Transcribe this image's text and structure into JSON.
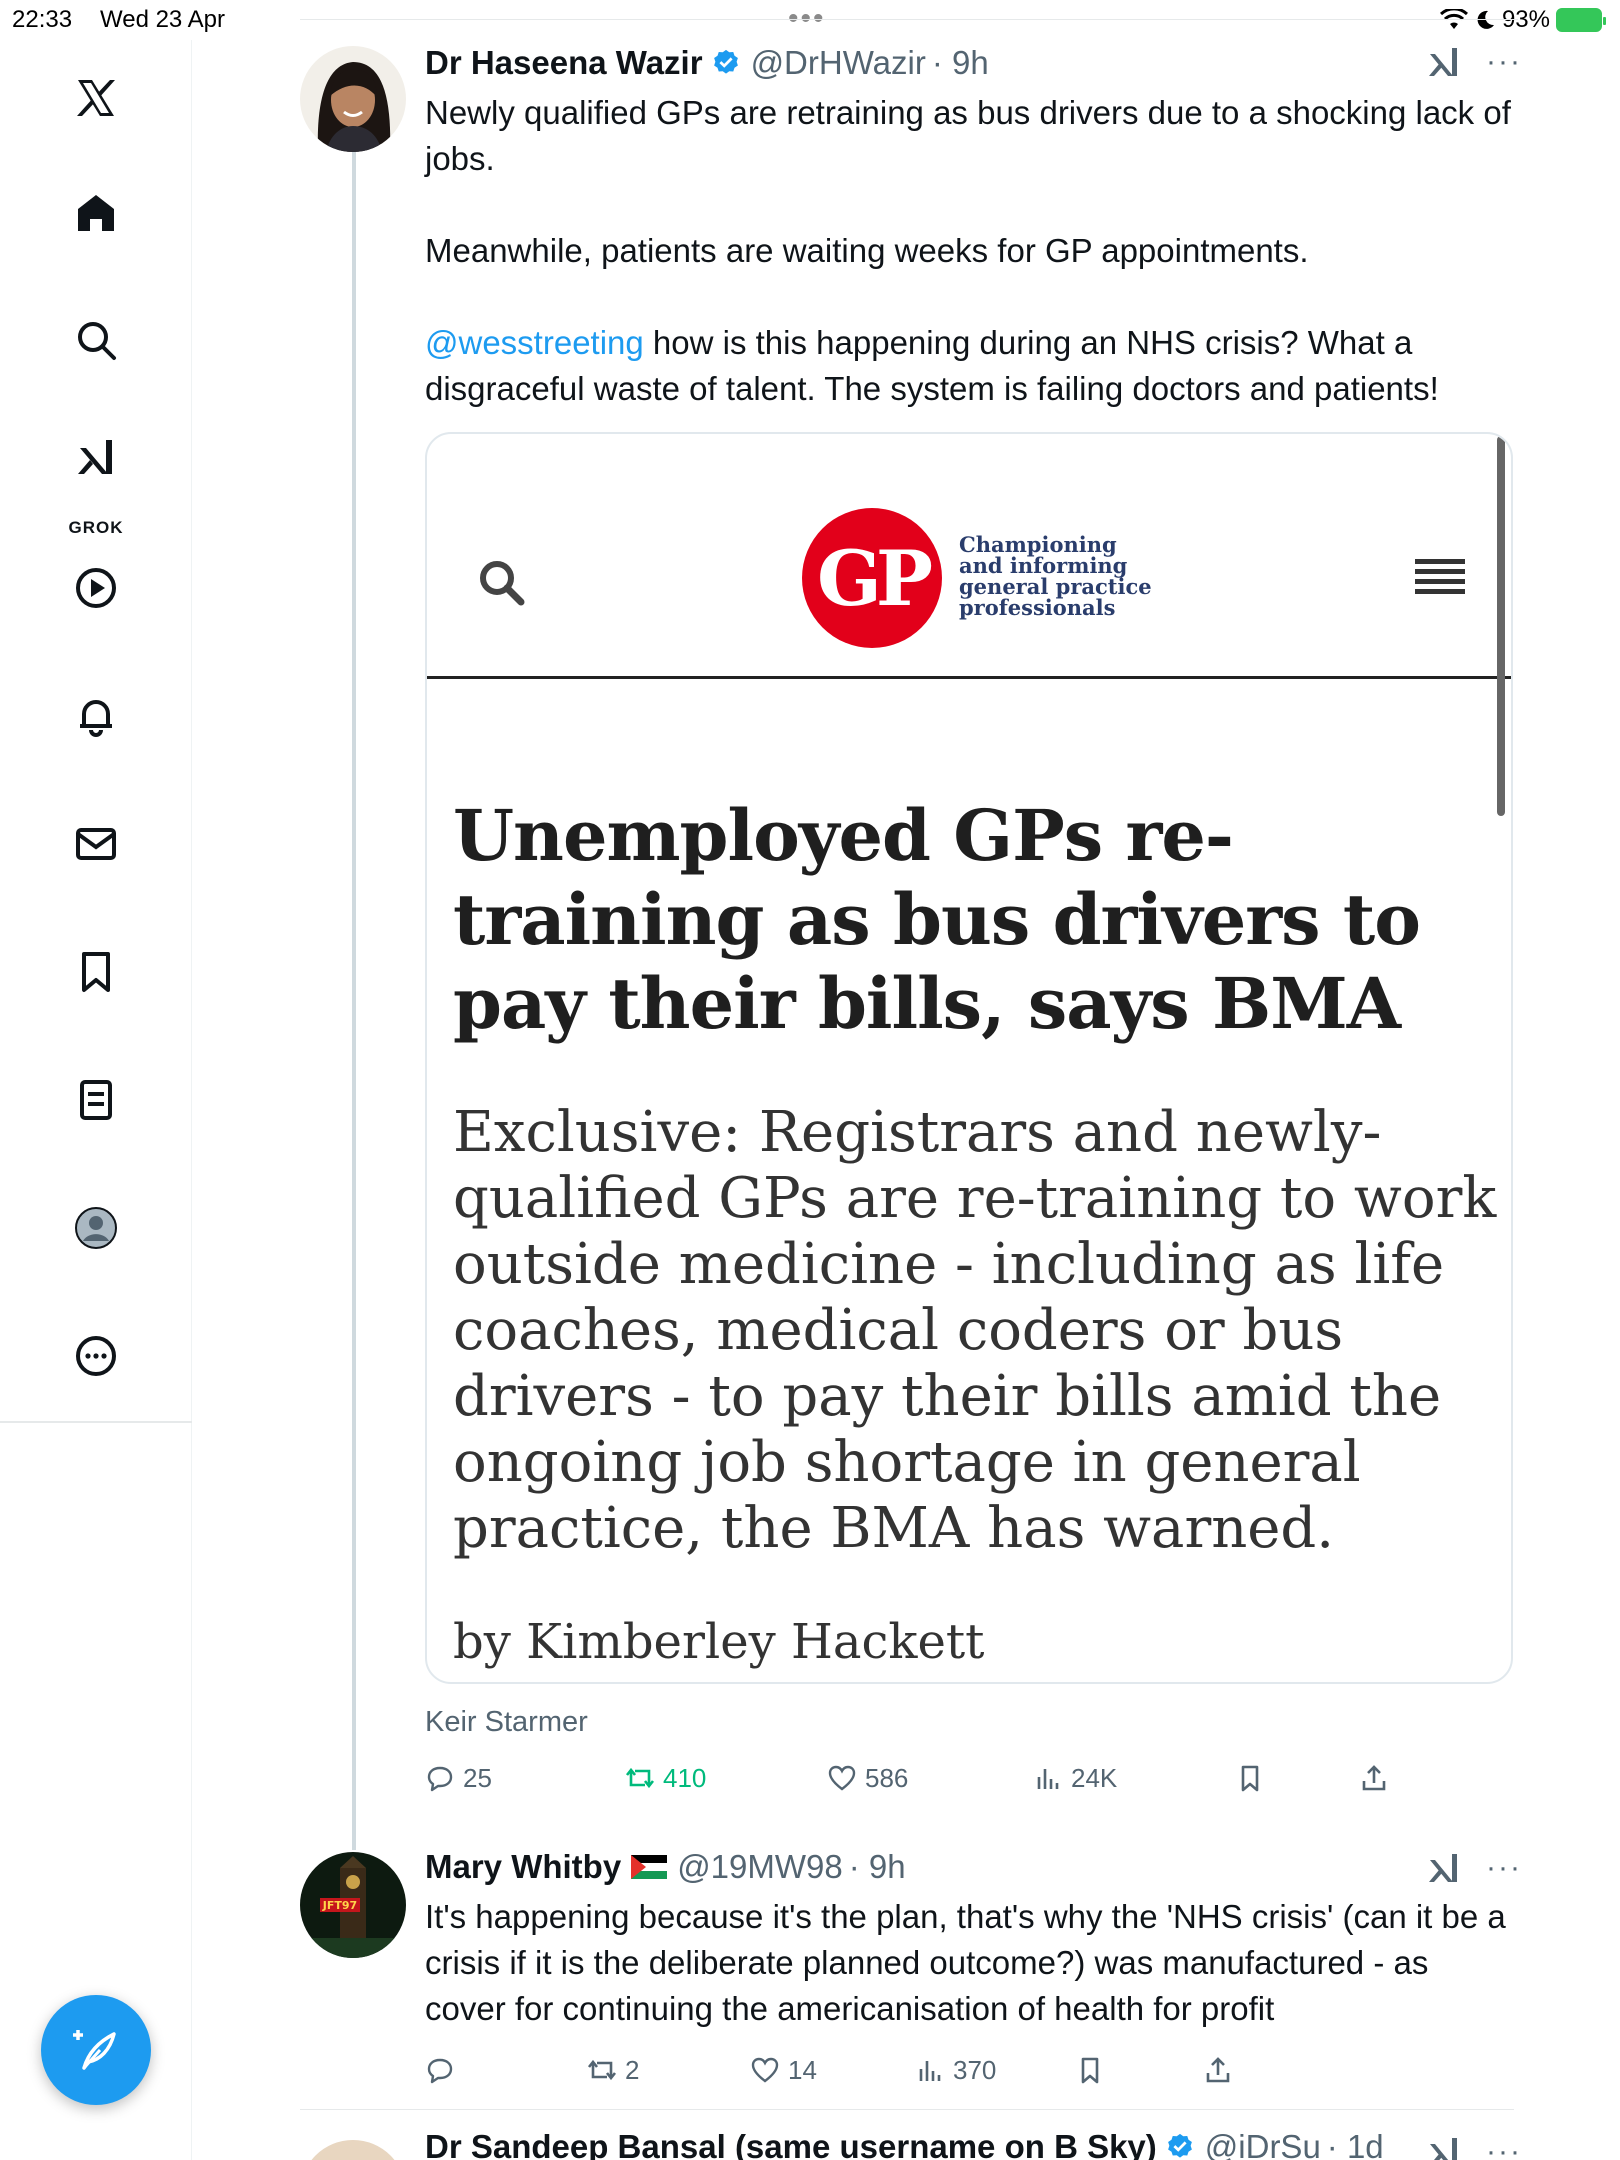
{
  "status": {
    "time": "22:33",
    "date": "Wed 23 Apr",
    "dots": "•••",
    "battery": "93%"
  },
  "sidebar": {
    "items": [
      {
        "name": "x-logo-icon"
      },
      {
        "name": "home-icon"
      },
      {
        "name": "search-icon"
      },
      {
        "name": "grok-icon",
        "label": "GROK"
      },
      {
        "name": "video-icon"
      },
      {
        "name": "notifications-icon"
      },
      {
        "name": "messages-icon"
      },
      {
        "name": "bookmarks-icon"
      },
      {
        "name": "lists-icon"
      },
      {
        "name": "profile-icon"
      },
      {
        "name": "more-icon"
      }
    ],
    "compose_label": "compose-icon"
  },
  "tweet1": {
    "author": "Dr Haseena Wazir",
    "handle": "@DrHWazir",
    "time": "· 9h",
    "text_1": "Newly qualified GPs are retraining as bus drivers due to a shocking lack of jobs.",
    "text_2": "Meanwhile, patients are waiting weeks for GP appointments.",
    "mention": "@wesstreeting",
    "text_3": " how is this happening during an NHS crisis? What a disgraceful waste of talent. The system is failing doctors and patients!",
    "card": {
      "logo": "GP",
      "tagline": [
        "Championing",
        "and informing",
        "general practice",
        "professionals"
      ],
      "title": "Unemployed GPs re-training as bus drivers to pay their bills, says BMA",
      "summary": "Exclusive: Registrars and newly-qualified GPs are re-training to work outside medicine - including as life coaches, medical coders or bus drivers - to pay their bills amid the ongoing job shortage in general practice, the BMA has warned.",
      "byline": "by Kimberley Hackett"
    },
    "source": "Keir Starmer",
    "replies": "25",
    "retweets": "410",
    "likes": "586",
    "views": "24K"
  },
  "tweet2": {
    "author": "Mary Whitby",
    "handle": "@19MW98",
    "time": "· 9h",
    "avatar_text": "JFT97",
    "text": "It's happening because it's the plan, that's why the 'NHS crisis' (can it be a crisis if it is the deliberate planned outcome?) was manufactured - as cover for continuing the americanisation of health for profit",
    "replies": "",
    "retweets": "2",
    "likes": "14",
    "views": "370"
  },
  "tweet3": {
    "author": "Dr Sandeep Bansal (same username on B Sky)",
    "handle": "@iDrSu",
    "time": "· 1d"
  },
  "colors": {
    "accent": "#1d9bf0",
    "retweet": "#00ba7c",
    "gp_red": "#e2001a"
  }
}
